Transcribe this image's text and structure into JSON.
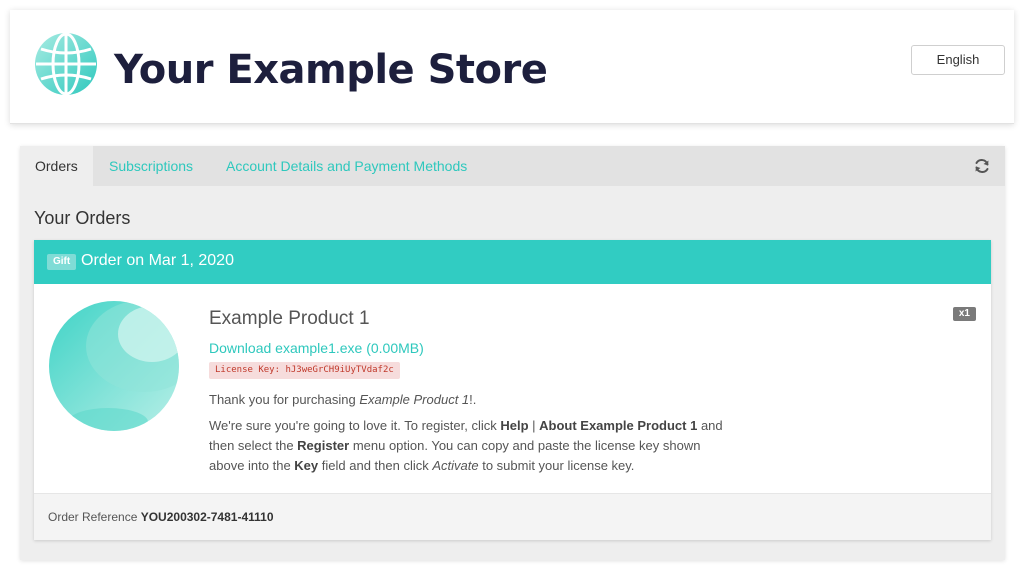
{
  "header": {
    "store_name": "Your Example Store",
    "language": "English"
  },
  "tabs": [
    {
      "label": "Orders",
      "active": true
    },
    {
      "label": "Subscriptions",
      "active": false
    },
    {
      "label": "Account Details and Payment Methods",
      "active": false
    }
  ],
  "section_title": "Your Orders",
  "order": {
    "gift_badge": "Gift",
    "title": "Order on Mar 1, 2020",
    "product_name": "Example Product 1",
    "download_link": "Download example1.exe (0.00MB)",
    "license_key": "License Key: hJ3weGrCH9iUyTVdaf2c",
    "quantity": "x1",
    "thanks_prefix": "Thank you for purchasing ",
    "thanks_product": "Example Product 1",
    "thanks_suffix": "!.",
    "instructions": {
      "p1": "We're sure you're going to love it. To register, click ",
      "b1": "Help",
      "p2": " | ",
      "b2": "About Example Product 1",
      "p3": " and then select the ",
      "b3": "Register",
      "p4": " menu option. You can copy and paste the license key shown above into the ",
      "b4": "Key",
      "p5": " field and then click ",
      "i1": "Activate",
      "p6": " to submit your license key."
    },
    "reference_label": "Order Reference ",
    "reference_value": "YOU200302-7481-41110"
  },
  "icons": {
    "logo": "globe-logo-icon",
    "refresh": "refresh-icon",
    "product": "product-sphere-image"
  },
  "colors": {
    "accent": "#31ccc2",
    "link": "#2ec8bd",
    "brand_text": "#1d1f3d",
    "license_bg": "#f6dcdc",
    "license_text": "#c0392b"
  }
}
